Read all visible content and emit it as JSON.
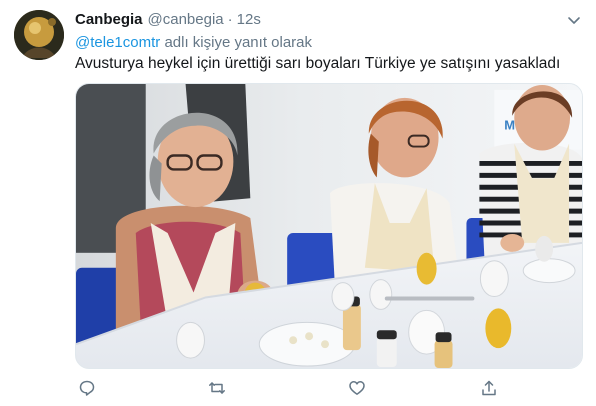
{
  "tweet": {
    "display_name": "Canbegia",
    "handle": "@canbegia",
    "separator": "·",
    "timestamp": "12s",
    "reply_to_handle": "@tele1comtr",
    "reply_suffix": "adlı kişiye yanıt olarak",
    "text": "Avusturya heykel için ürettiği sarı boyaları Türkiye ye satışını yasakladı",
    "media_sign_text": "Muğla"
  },
  "icons": {
    "avatar": "avatar-image",
    "caret": "chevron-down-icon",
    "reply": "reply-icon",
    "retweet": "retweet-icon",
    "like": "heart-icon",
    "share": "share-icon"
  },
  "colors": {
    "text": "#14171a",
    "secondary": "#657786",
    "link": "#1b95e0",
    "border": "#e1e8ed"
  }
}
